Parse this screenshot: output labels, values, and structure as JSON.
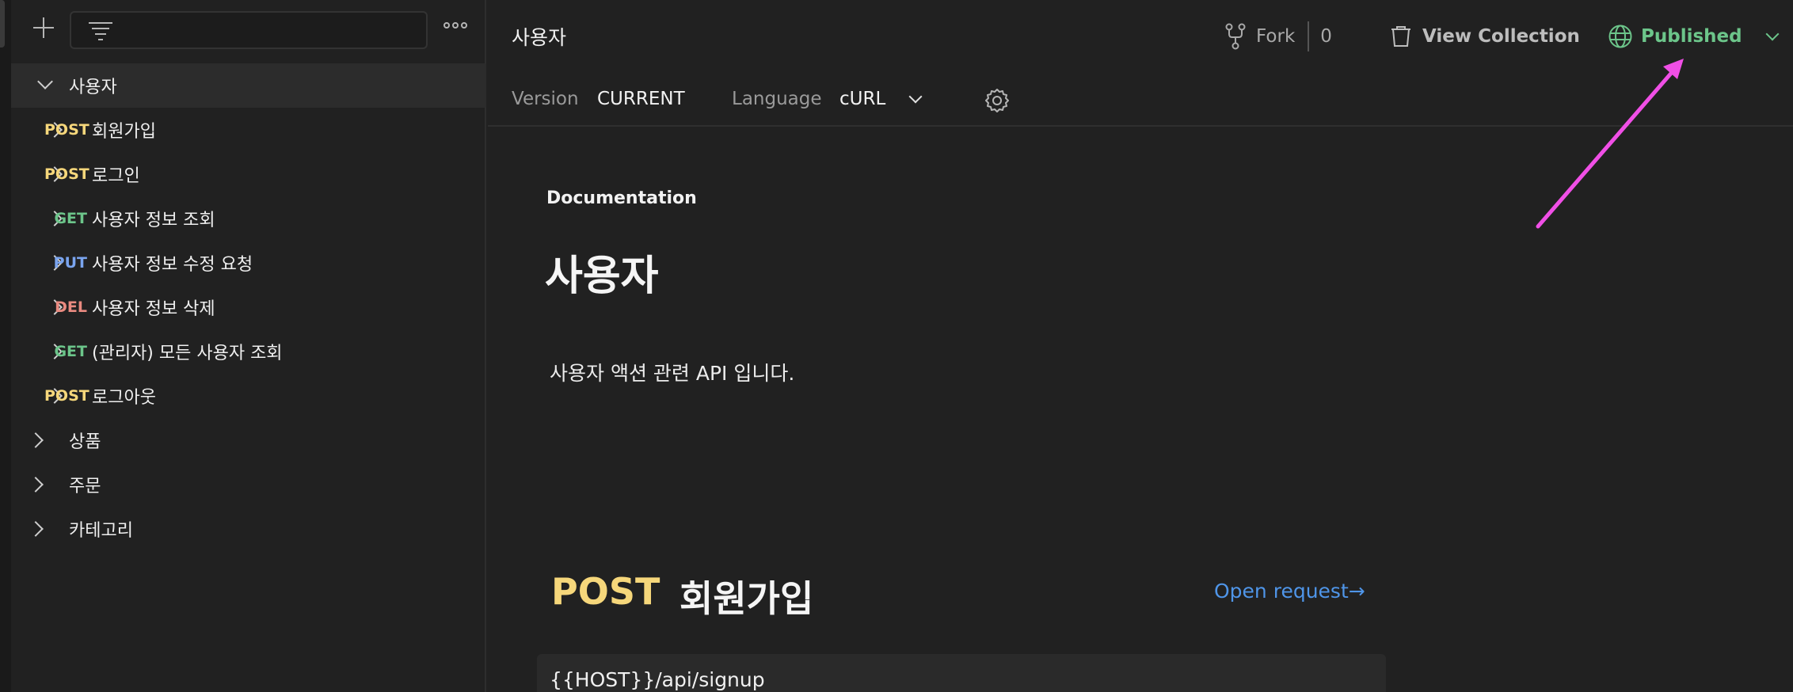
{
  "sidebar": {
    "filter_placeholder": "",
    "tree": [
      {
        "label": "사용자",
        "method": "",
        "expanded": true,
        "level": 0
      },
      {
        "label": "회원가입",
        "method": "POST",
        "level": 1
      },
      {
        "label": "로그인",
        "method": "POST",
        "level": 1
      },
      {
        "label": "사용자 정보 조회",
        "method": "GET",
        "level": 1
      },
      {
        "label": "사용자 정보 수정 요청",
        "method": "PUT",
        "level": 1
      },
      {
        "label": "사용자 정보 삭제",
        "method": "DEL",
        "level": 1
      },
      {
        "label": "(관리자) 모든 사용자 조회",
        "method": "GET",
        "level": 1
      },
      {
        "label": "로그아웃",
        "method": "POST",
        "level": 1
      },
      {
        "label": "상품",
        "method": "",
        "level": 0
      },
      {
        "label": "주문",
        "method": "",
        "level": 0
      },
      {
        "label": "카테고리",
        "method": "",
        "level": 0
      }
    ]
  },
  "header": {
    "title": "사용자",
    "fork_label": "Fork",
    "fork_count": "0",
    "view_collection_label": "View Collection",
    "published_label": "Published"
  },
  "subbar": {
    "version_label": "Version",
    "version_value": "CURRENT",
    "language_label": "Language",
    "language_value": "cURL"
  },
  "doc": {
    "section_label": "Documentation",
    "title": "사용자",
    "description": "사용자 액션 관련 API 입니다."
  },
  "request": {
    "method": "POST",
    "name": "회원가입",
    "open_label": "Open request→",
    "url": "{{HOST}}/api/signup"
  },
  "colors": {
    "post": "#f6d77b",
    "get": "#6cc58a",
    "put": "#7aa4ee",
    "del": "#e98a80",
    "published": "#6cc58a",
    "link": "#4f95e8",
    "annotation_arrow": "#f04fe6"
  }
}
